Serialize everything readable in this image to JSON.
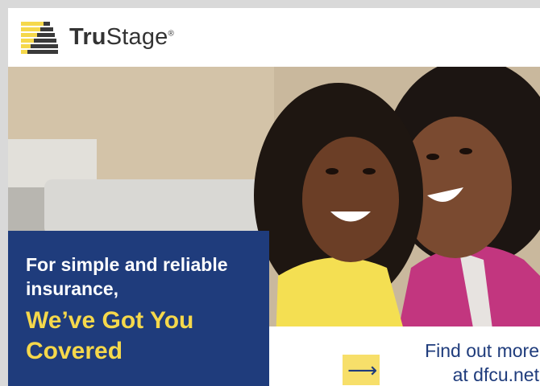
{
  "brand": {
    "name_bold": "Tru",
    "name_regular": "Stage",
    "trademark": "®",
    "logo_color": "#f5d84b",
    "logo_bars_color": "#3a3a3a"
  },
  "ad": {
    "tagline": "For simple and reliable insurance,",
    "headline": "We’ve Got You Covered",
    "cta_line1": "Find out more",
    "cta_line2": "at dfcu.net",
    "cta_icon": "arrow-right-icon",
    "colors": {
      "panel_blue": "#1f3c7c",
      "headline_yellow": "#f5d84b",
      "arrow_box_yellow": "#f7df6a"
    }
  },
  "photo": {
    "description_icon": "photo-image"
  }
}
